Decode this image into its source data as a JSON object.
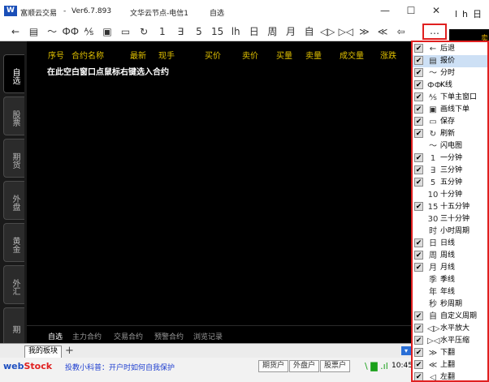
{
  "peek": {
    "tools": [
      "lh",
      "日"
    ],
    "header": "卖价"
  },
  "window": {
    "app_name": "富顺云交易",
    "separator": "-",
    "version": "Ver6.7.893",
    "server": "文华云节点-电信1",
    "mode": "自选",
    "controls": {
      "minimize": "—",
      "maximize": "☐",
      "close": "✕"
    }
  },
  "toolbar": {
    "items": [
      {
        "name": "back-icon",
        "glyph": "←"
      },
      {
        "name": "quote-icon",
        "glyph": "▤"
      },
      {
        "name": "timeshare-icon",
        "glyph": "〜"
      },
      {
        "name": "candle-icon",
        "glyph": "ФФ"
      },
      {
        "name": "order-icon",
        "glyph": "⅍"
      },
      {
        "name": "draw-order-icon",
        "glyph": "▣"
      },
      {
        "name": "save-icon",
        "glyph": "▭"
      },
      {
        "name": "refresh-icon",
        "glyph": "↻"
      },
      {
        "name": "one-minute-icon",
        "glyph": "1"
      },
      {
        "name": "three-minute-icon",
        "glyph": "∃"
      },
      {
        "name": "five-minute-icon",
        "glyph": "5"
      },
      {
        "name": "fifteen-minute-icon",
        "glyph": "15"
      },
      {
        "name": "hour-icon",
        "glyph": "lh"
      },
      {
        "name": "day-icon",
        "glyph": "日"
      },
      {
        "name": "week-icon",
        "glyph": "周"
      },
      {
        "name": "month-icon",
        "glyph": "月"
      },
      {
        "name": "custom-icon",
        "glyph": "自"
      },
      {
        "name": "zoom-in-icon",
        "glyph": "◁▷"
      },
      {
        "name": "zoom-out-icon",
        "glyph": "▷◁"
      },
      {
        "name": "page-down-icon",
        "glyph": "≫"
      },
      {
        "name": "page-up-icon",
        "glyph": "≪"
      },
      {
        "name": "return-icon",
        "glyph": "⇦"
      }
    ],
    "more": "…"
  },
  "side_tabs": [
    "自选",
    "股票",
    "期货",
    "外盘",
    "黄金",
    "外汇",
    "期"
  ],
  "grid": {
    "columns": [
      "序号",
      "合约名称",
      "最新",
      "现手",
      "买价",
      "卖价",
      "买量",
      "卖量",
      "成交量",
      "涨跌"
    ],
    "hint": "在此空白窗口点鼠标右键选入合约"
  },
  "bottom_tabs": [
    "自选",
    "主力合约",
    "交易合约",
    "预警合约",
    "浏览记录"
  ],
  "panel": {
    "tab": "我的板块",
    "add": "+"
  },
  "status": {
    "brand_a": "web",
    "brand_b": "Stock",
    "ticker": "投教小科普：开户时如何自我保护",
    "buttons": [
      "期货户",
      "外盘户",
      "股票户"
    ],
    "signal": "\\ ▇ .ıl",
    "time": "10:45"
  },
  "menu": {
    "items": [
      {
        "label": "后退",
        "icon": "←",
        "checked": true
      },
      {
        "label": "报价",
        "icon": "▤",
        "checked": true,
        "highlighted": true
      },
      {
        "label": "分时",
        "icon": "〜",
        "checked": true
      },
      {
        "label": "K线",
        "icon": "ФФ",
        "checked": true
      },
      {
        "label": "下单主窗口",
        "icon": "⅍",
        "checked": true
      },
      {
        "label": "画线下单",
        "icon": "▣",
        "checked": true
      },
      {
        "label": "保存",
        "icon": "▭",
        "checked": true
      },
      {
        "label": "刷新",
        "icon": "↻",
        "checked": true
      },
      {
        "label": "闪电图",
        "icon": "〜",
        "checked": false
      },
      {
        "label": "一分钟",
        "icon": "1",
        "checked": true
      },
      {
        "label": "三分钟",
        "icon": "∃",
        "checked": true
      },
      {
        "label": "五分钟",
        "icon": "5",
        "checked": true
      },
      {
        "label": "十分钟",
        "icon": "10",
        "checked": false
      },
      {
        "label": "十五分钟",
        "icon": "15",
        "checked": true
      },
      {
        "label": "三十分钟",
        "icon": "30",
        "checked": false
      },
      {
        "label": "小时周期",
        "icon": "时",
        "checked": false
      },
      {
        "label": "日线",
        "icon": "日",
        "checked": true
      },
      {
        "label": "周线",
        "icon": "周",
        "checked": true
      },
      {
        "label": "月线",
        "icon": "月",
        "checked": true
      },
      {
        "label": "季线",
        "icon": "季",
        "checked": false
      },
      {
        "label": "年线",
        "icon": "年",
        "checked": false
      },
      {
        "label": "秒周期",
        "icon": "秒",
        "checked": false
      },
      {
        "label": "自定义周期",
        "icon": "自",
        "checked": true
      },
      {
        "label": "水平放大",
        "icon": "◁▷",
        "checked": true
      },
      {
        "label": "水平压缩",
        "icon": "▷◁",
        "checked": true
      },
      {
        "label": "下翻",
        "icon": "≫",
        "checked": true
      },
      {
        "label": "上翻",
        "icon": "≪",
        "checked": true
      },
      {
        "label": "左翻",
        "icon": "◁",
        "checked": true
      }
    ]
  }
}
